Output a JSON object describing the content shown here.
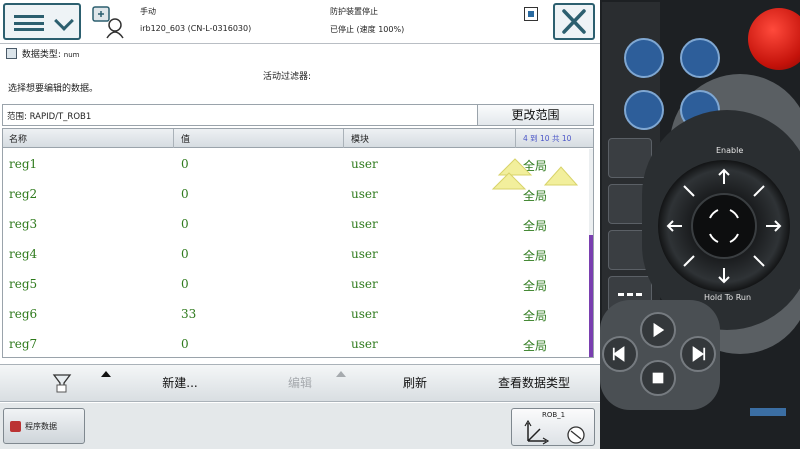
{
  "topbar": {
    "mode": "手动",
    "robot": "irb120_603 (CN-L-0316030)",
    "safety": "防护装置停止",
    "state": "已停止 (速度 100%)"
  },
  "header": {
    "datatype_label": "数据类型:",
    "datatype_value": "num",
    "filter_label": "活动过滤器:",
    "prompt": "选择想要编辑的数据。"
  },
  "scope": {
    "text": "范围: RAPID/T_ROB1",
    "change_button": "更改范围"
  },
  "table": {
    "columns": [
      "名称",
      "值",
      "模块"
    ],
    "counter": "4 到 10 共 10",
    "rows": [
      {
        "name": "reg1",
        "value": "0",
        "module": "user",
        "scope": "全局"
      },
      {
        "name": "reg2",
        "value": "0",
        "module": "user",
        "scope": "全局"
      },
      {
        "name": "reg3",
        "value": "0",
        "module": "user",
        "scope": "全局"
      },
      {
        "name": "reg4",
        "value": "0",
        "module": "user",
        "scope": "全局"
      },
      {
        "name": "reg5",
        "value": "0",
        "module": "user",
        "scope": "全局"
      },
      {
        "name": "reg6",
        "value": "33",
        "module": "user",
        "scope": "全局"
      },
      {
        "name": "reg7",
        "value": "0",
        "module": "user",
        "scope": "全局"
      }
    ]
  },
  "toolbar": {
    "new": "新建...",
    "edit": "编辑",
    "refresh": "刷新",
    "view_datatypes": "查看数据类型"
  },
  "statusbar": {
    "program_data_tab": "程序数据",
    "quickset": "ROB_1"
  },
  "hardware": {
    "enable": "Enable",
    "hold_to_run": "Hold To Run"
  },
  "colors": {
    "value_green": "#2e7a1c",
    "accent_teal": "#2c5f6f",
    "scroll_purple": "#7a3fb0",
    "estop_red": "#d1170d"
  }
}
